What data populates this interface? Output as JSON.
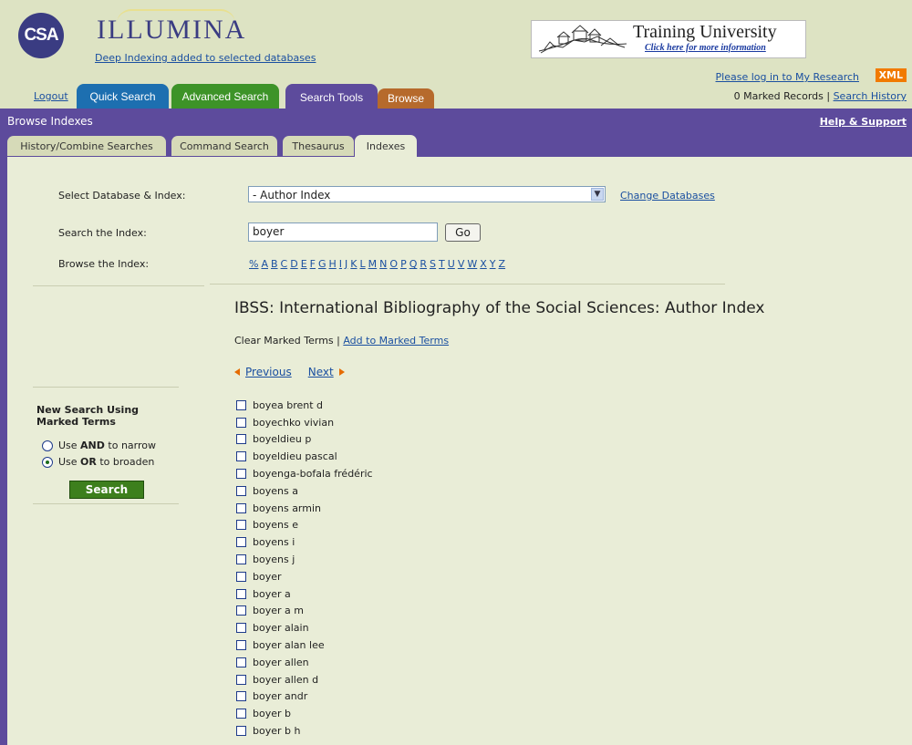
{
  "header": {
    "logo_text": "CSA",
    "brand": "ILLUMINA",
    "tagline": "Deep Indexing added to selected databases",
    "banner_title": "Training University",
    "banner_subtitle": "Click here for more information",
    "login_link": "Please log in to My Research",
    "xml_badge": "XML",
    "logout": "Logout",
    "records_text": "0 Marked Records | ",
    "search_history": "Search History"
  },
  "main_tabs": {
    "quick_search": "Quick Search",
    "advanced_search": "Advanced Search",
    "search_tools": "Search Tools",
    "browse": "Browse"
  },
  "subheader": {
    "title": "Browse Indexes",
    "help": "Help & Support"
  },
  "sub_tabs": {
    "history": "History/Combine Searches",
    "command": "Command Search",
    "thesaurus": "Thesaurus",
    "indexes": "Indexes"
  },
  "form": {
    "select_label": "Select Database & Index:",
    "select_value": "- Author Index",
    "change_databases": "Change Databases",
    "search_label": "Search the Index:",
    "search_value": "boyer",
    "go": "Go",
    "browse_label": "Browse the Index:",
    "alphabet": [
      "%",
      "A",
      "B",
      "C",
      "D",
      "E",
      "F",
      "G",
      "H",
      "I",
      "J",
      "K",
      "L",
      "M",
      "N",
      "O",
      "P",
      "Q",
      "R",
      "S",
      "T",
      "U",
      "V",
      "W",
      "X",
      "Y",
      "Z"
    ]
  },
  "results": {
    "title": "IBSS: International Bibliography of the Social Sciences: Author Index",
    "clear_marked": "Clear Marked Terms | ",
    "add_marked": "Add to Marked Terms",
    "previous": "Previous",
    "next": "Next",
    "terms": [
      "boyea brent d",
      "boyechko vivian",
      "boyeldieu p",
      "boyeldieu pascal",
      "boyenga-bofala frédéric",
      "boyens a",
      "boyens armin",
      "boyens e",
      "boyens i",
      "boyens j",
      "boyer",
      "boyer a",
      "boyer a m",
      "boyer alain",
      "boyer alan lee",
      "boyer allen",
      "boyer allen d",
      "boyer andr",
      "boyer b",
      "boyer b h"
    ]
  },
  "new_search": {
    "heading_line1": "New Search Using",
    "heading_line2": "Marked Terms",
    "and_pre": "Use ",
    "and_bold": "AND",
    "and_post": " to narrow",
    "or_pre": "Use ",
    "or_bold": "OR",
    "or_post": " to broaden",
    "selected": "OR",
    "button": "Search"
  }
}
